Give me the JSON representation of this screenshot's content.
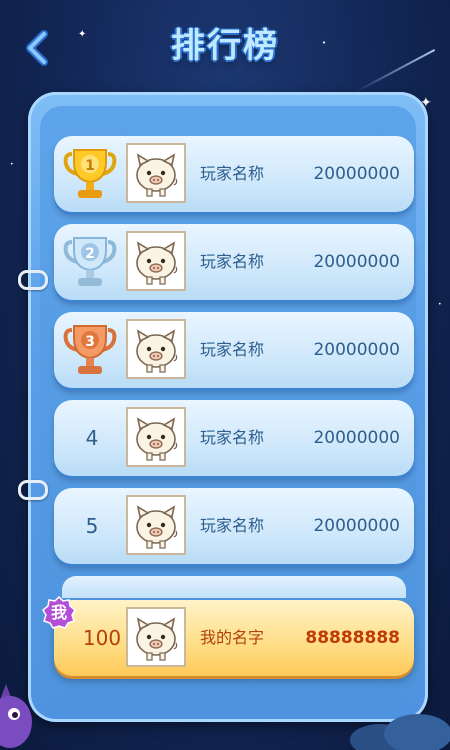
{
  "header": {
    "title": "排行榜"
  },
  "colors": {
    "background": "#14295a",
    "board": "#5a9fe9",
    "row": "#cfe8fb",
    "my_row": "#ffdd85",
    "text": "#2f5e8c",
    "my_text": "#b2420b",
    "me_badge": "#b24fd6"
  },
  "leaderboard": [
    {
      "rank": "1",
      "rank_icon": "gold-trophy-icon",
      "player": "玩家名称",
      "score": "20000000"
    },
    {
      "rank": "2",
      "rank_icon": "silver-trophy-icon",
      "player": "玩家名称",
      "score": "20000000"
    },
    {
      "rank": "3",
      "rank_icon": "bronze-trophy-icon",
      "player": "玩家名称",
      "score": "20000000"
    },
    {
      "rank": "4",
      "player": "玩家名称",
      "score": "20000000"
    },
    {
      "rank": "5",
      "player": "玩家名称",
      "score": "20000000"
    }
  ],
  "my_entry": {
    "badge": "我",
    "rank": "100",
    "player": "我的名字",
    "score": "88888888"
  },
  "icons": {
    "back": "back-chevron-icon",
    "avatar": "pig-avatar-icon"
  }
}
